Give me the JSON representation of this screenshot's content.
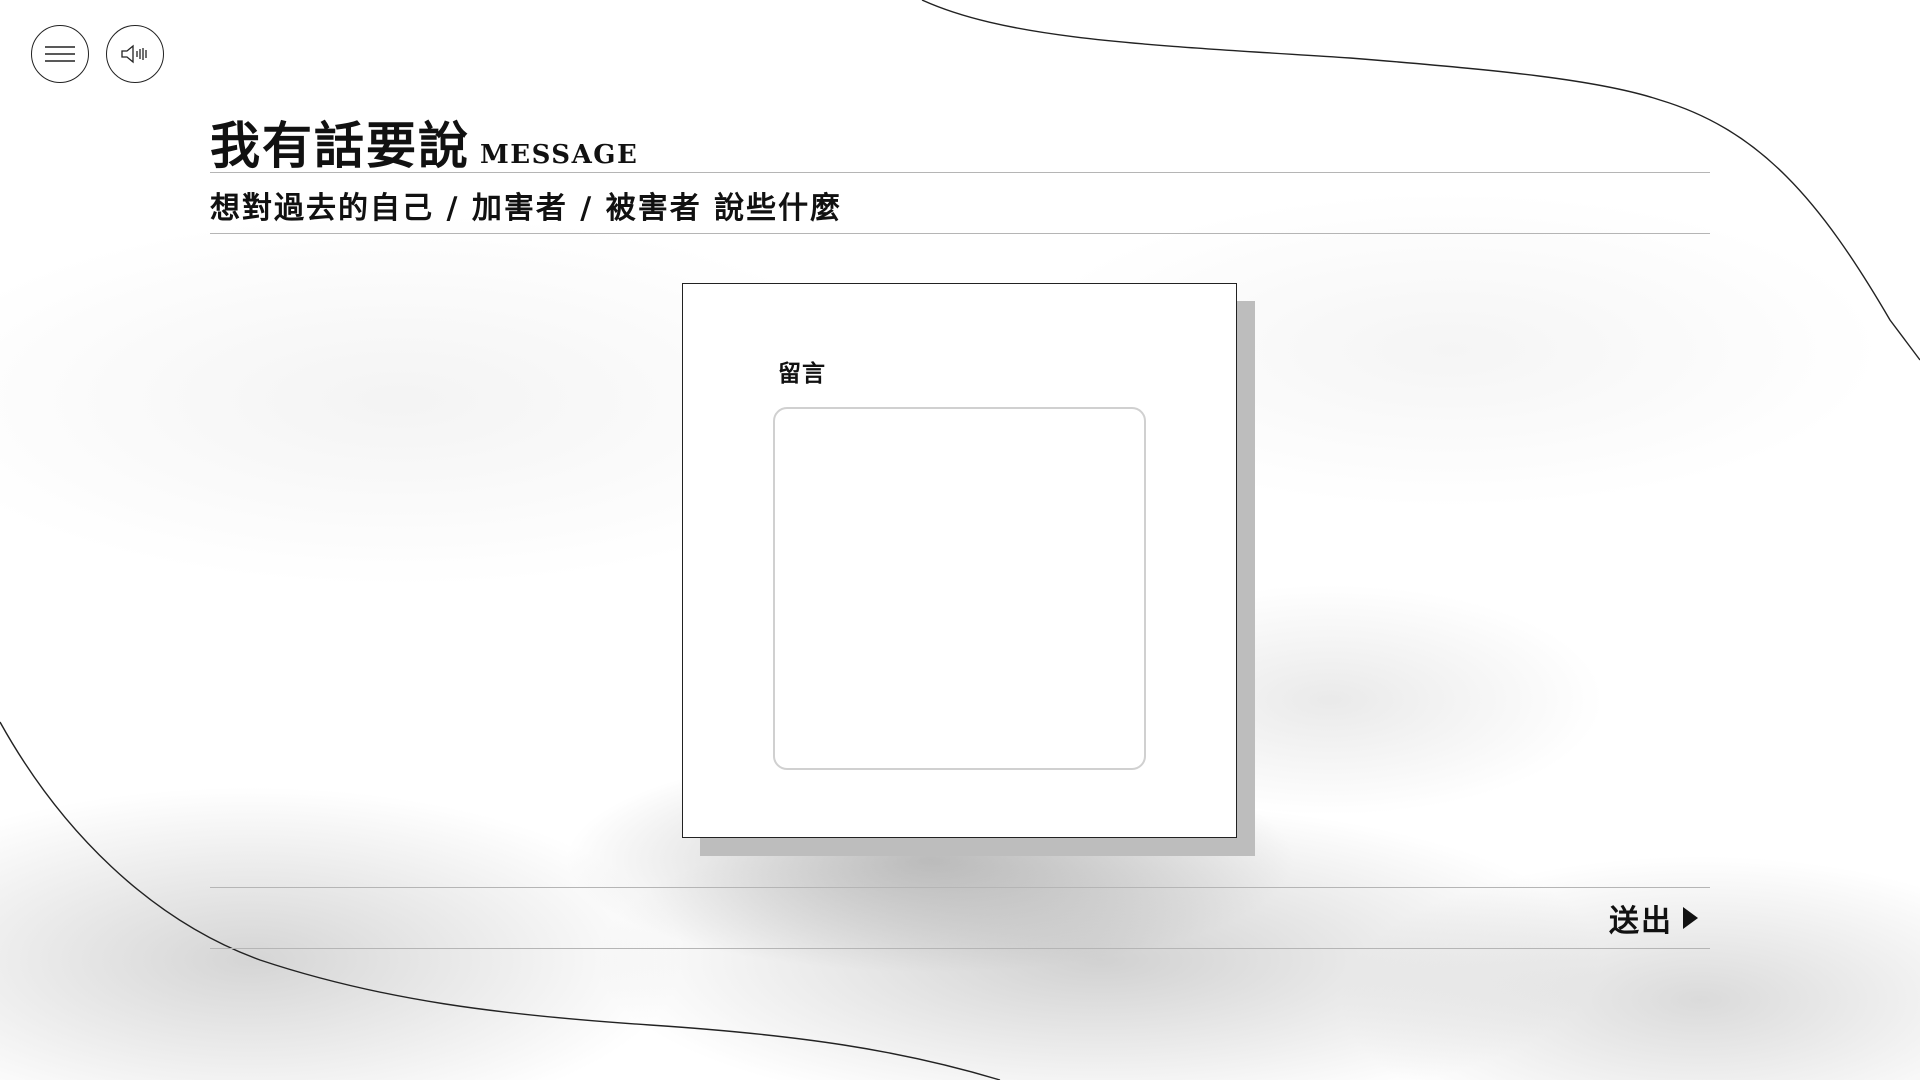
{
  "header": {
    "menu_icon": "hamburger-menu-icon",
    "sound_icon": "speaker-icon",
    "title_zh": "我有話要說",
    "title_en": "MESSAGE",
    "subtitle": "想對過去的自己 / 加害者 / 被害者 說些什麼"
  },
  "form": {
    "message_label": "留言",
    "message_value": "",
    "submit_label": "送出",
    "submit_icon": "play-triangle-icon"
  },
  "colors": {
    "background": "#ffffff",
    "text": "#111111",
    "divider": "#b5b5b5",
    "card_shadow": "#bdbdbd",
    "input_border": "#d0d0d0"
  }
}
